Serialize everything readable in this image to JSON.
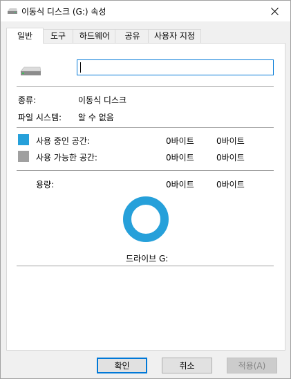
{
  "window": {
    "title": "이동식 디스크 (G:) 속성",
    "close_icon": "close-icon"
  },
  "tabs": [
    {
      "label": "일반",
      "active": true
    },
    {
      "label": "도구",
      "active": false
    },
    {
      "label": "하드웨어",
      "active": false
    },
    {
      "label": "공유",
      "active": false
    },
    {
      "label": "사용자 지정",
      "active": false
    }
  ],
  "general": {
    "name_value": "",
    "type_label": "종류:",
    "type_value": "이동식 디스크",
    "fs_label": "파일 시스템:",
    "fs_value": "알 수 없음",
    "used": {
      "label": "사용 중인 공간:",
      "bytes": "0바이트",
      "size": "0바이트",
      "color": "#26a0da"
    },
    "free": {
      "label": "사용 가능한 공간:",
      "bytes": "0바이트",
      "size": "0바이트",
      "color": "#a0a0a0"
    },
    "capacity": {
      "label": "용량:",
      "bytes": "0바이트",
      "size": "0바이트"
    },
    "drive_label": "드라이브 G:",
    "donut_color": "#26a0da"
  },
  "buttons": {
    "ok": "확인",
    "cancel": "취소",
    "apply": "적용(A)"
  }
}
